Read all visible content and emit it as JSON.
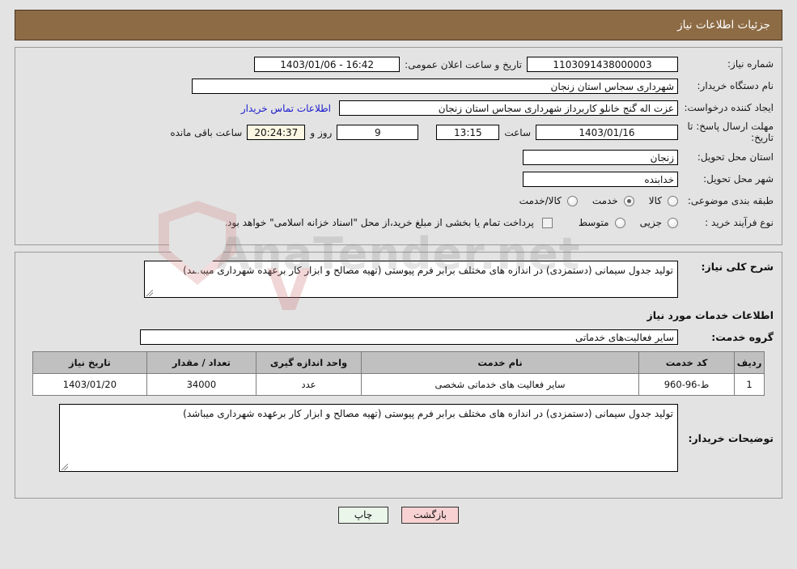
{
  "header": {
    "title": "جزئیات اطلاعات نیاز"
  },
  "info": {
    "need_number": {
      "label": "شماره نیاز:",
      "value": "1103091438000003"
    },
    "public_announce": {
      "label": "تاریخ و ساعت اعلان عمومی:",
      "value": "16:42 - 1403/01/06"
    },
    "buyer_org": {
      "label": "نام دستگاه خریدار:",
      "value": "شهرداری سجاس استان زنجان"
    },
    "creator": {
      "label": "ایجاد کننده درخواست:",
      "value": "عزت اله گنج خانلو کاربرداز شهرداری سجاس استان زنجان"
    },
    "contact_link": "اطلاعات تماس خریدار",
    "deadline": {
      "label": "مهلت ارسال پاسخ: تا تاریخ:",
      "date": "1403/01/16",
      "time_word": "ساعت",
      "time": "13:15",
      "days": "9",
      "days_word": "روز و",
      "clock": "20:24:37",
      "remaining_word": "ساعت باقی مانده"
    },
    "province": {
      "label": "استان محل تحویل:",
      "value": "زنجان"
    },
    "city": {
      "label": "شهر محل تحویل:",
      "value": "خدابنده"
    },
    "category": {
      "label": "طبقه بندی موضوعی:",
      "options": [
        "کالا",
        "خدمت",
        "کالا/خدمت"
      ],
      "selected": "خدمت"
    },
    "process_type": {
      "label": "نوع فرآیند خرید :",
      "options": [
        "جزیی",
        "متوسط"
      ],
      "selected": "",
      "checkbox_text": "پرداخت تمام یا بخشی از مبلغ خرید،از محل \"اسناد خزانه اسلامی\" خواهد بود.",
      "checkbox_checked": false
    }
  },
  "detail": {
    "need_desc": {
      "label": "شرح کلی نیاز:",
      "value": "تولید جدول سیمانی (دستمزدی) در اندازه های مختلف برابر فرم پیوستی (تهیه مصالح و ابزار کار برعهده شهرداری میباشد)"
    },
    "services_section_title": "اطلاعات خدمات مورد نیاز",
    "service_group": {
      "label": "گروه خدمت:",
      "value": "سایر فعالیت‌های خدماتی"
    },
    "table": {
      "headers": [
        "ردیف",
        "کد خدمت",
        "نام خدمت",
        "واحد اندازه گیری",
        "تعداد / مقدار",
        "تاریخ نیاز"
      ],
      "rows": [
        {
          "radif": "1",
          "code": "ط-96-960",
          "name": "سایر فعالیت های خدماتی شخصی",
          "unit": "عدد",
          "qty": "34000",
          "date": "1403/01/20"
        }
      ]
    },
    "buyer_notes": {
      "label": "توضیحات خریدار:",
      "value": "تولید جدول سیمانی (دستمزدی) در اندازه های مختلف برابر فرم پیوستی (تهیه مصالح و ابزار کار برعهده شهرداری میباشد)"
    }
  },
  "buttons": {
    "print": "چاپ",
    "back": "بازگشت"
  },
  "watermark": {
    "text": "AnaTender.net"
  },
  "colors": {
    "header_bg": "#8d6b45",
    "panel_bg": "#e3e3e3",
    "link": "#1a1acd",
    "table_header_bg": "#c0c0c0",
    "btn_print_bg": "#e9f6e9",
    "btn_back_bg": "#f8d2d2",
    "cream_field": "#fbf7e2"
  }
}
